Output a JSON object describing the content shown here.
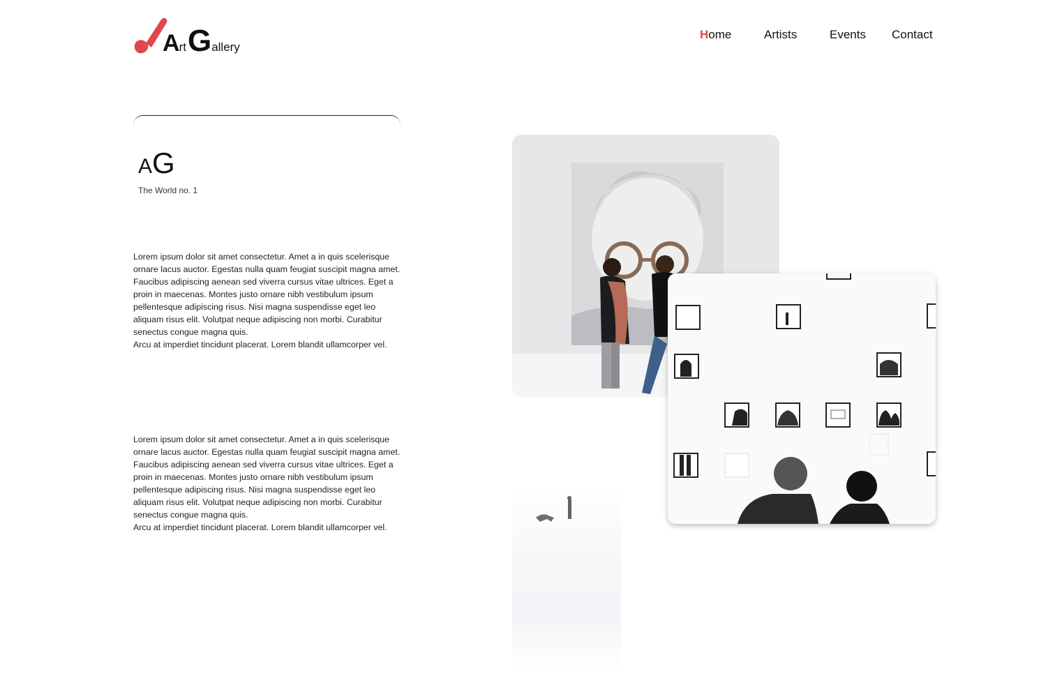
{
  "brand": {
    "logo_big_a": "A",
    "logo_rt": "rt",
    "logo_big_g": "G",
    "logo_allery": "allery",
    "accent_color": "#e0474c",
    "logo_icon": "paintbrush-icon"
  },
  "nav": {
    "home_first": "H",
    "home_rest": "ome",
    "artists": "Artists",
    "events": "Events",
    "contact": "Contact"
  },
  "intro": {
    "mark_a": "A",
    "mark_g": "G",
    "tagline": "The World no. 1"
  },
  "paragraphs": [
    {
      "body": "Lorem ipsum dolor sit amet consectetur. Amet a in quis scelerisque ornare lacus auctor. Egestas nulla quam feugiat suscipit magna amet. Faucibus adipiscing aenean sed viverra cursus vitae ultrices. Eget a proin in maecenas. Montes justo ornare nibh vestibulum ipsum pellentesque adipiscing risus. Nisi magna suspendisse eget leo aliquam risus elit. Volutpat neque adipiscing non morbi. Curabitur senectus congue magna quis.",
      "tail": "Arcu at imperdiet tincidunt placerat. Lorem blandit ullamcorper vel."
    },
    {
      "body": "Lorem ipsum dolor sit amet consectetur. Amet a in quis scelerisque ornare lacus auctor. Egestas nulla quam feugiat suscipit magna amet. Faucibus adipiscing aenean sed viverra cursus vitae ultrices. Eget a proin in maecenas. Montes justo ornare nibh vestibulum ipsum pellentesque adipiscing risus. Nisi magna suspendisse eget leo aliquam risus elit. Volutpat neque adipiscing non morbi. Curabitur senectus congue magna quis.",
      "tail": "Arcu at imperdiet tincidunt placerat. Lorem blandit ullamcorper vel."
    }
  ]
}
